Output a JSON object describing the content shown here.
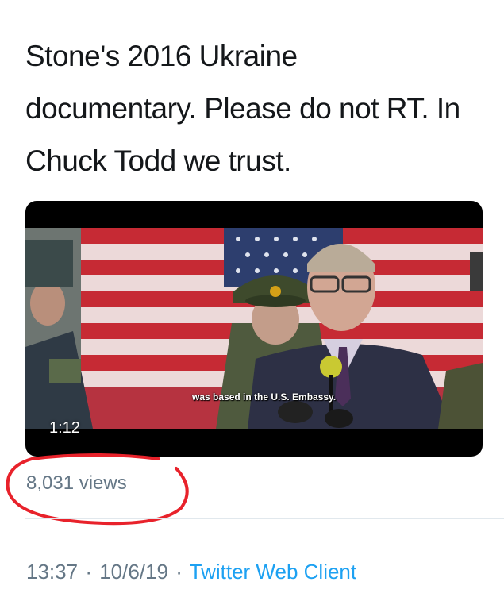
{
  "tweet": {
    "lines": [
      "Stone's 2016 Ukraine",
      "documentary. Please do not RT. In",
      "Chuck Todd we trust."
    ]
  },
  "video": {
    "subtitle": "was based in the U.S. Embassy.",
    "duration": "1:12"
  },
  "stats": {
    "views": "8,031 views"
  },
  "meta": {
    "time": "13:37",
    "date": "10/6/19",
    "separator": "·",
    "client": "Twitter Web Client"
  },
  "colors": {
    "text": "#14171a",
    "secondary": "#657786",
    "link": "#1da1f2",
    "annotation": "#e8222b"
  }
}
